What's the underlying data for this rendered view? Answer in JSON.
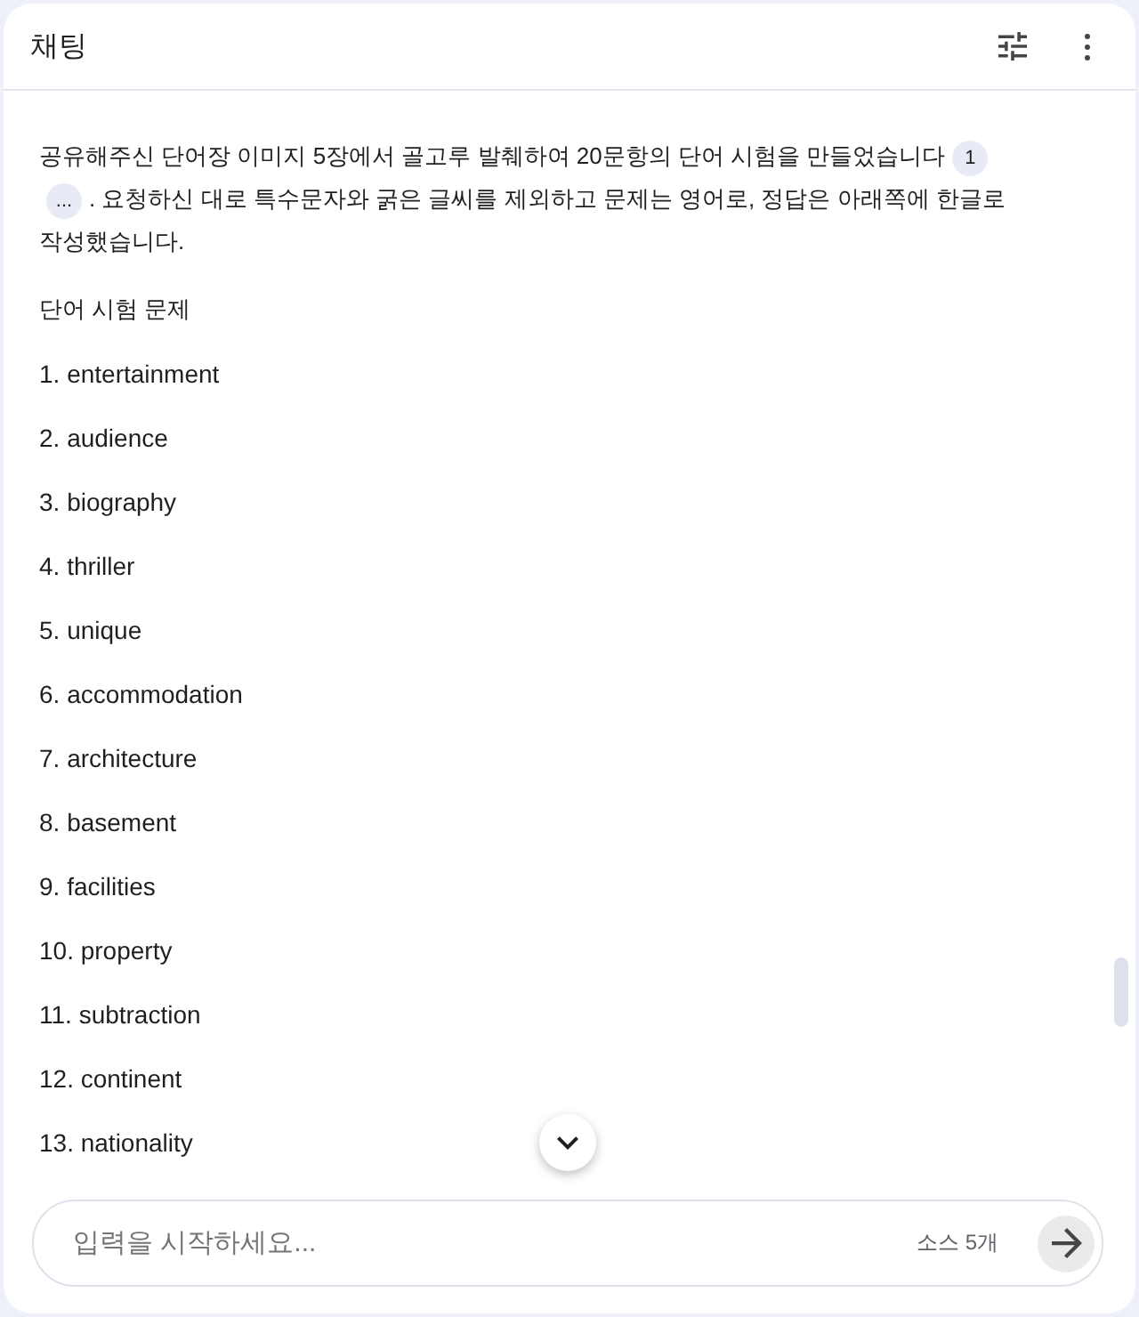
{
  "header": {
    "title": "채팅"
  },
  "message": {
    "intro_before": "공유해주신 단어장 이미지 5장에서 골고루 발췌하여 20문항의 단어 시험을 만들었습니다",
    "citations": [
      {
        "label": "1"
      },
      {
        "label": "..."
      }
    ],
    "intro_after": ". 요청하신 대로 특수문자와 굵은 글씨를 제외하고 문제는 영어로, 정답은 아래쪽에 한글로 작성했습니다.",
    "heading": "단어 시험 문제",
    "items": [
      "1. entertainment",
      "2. audience",
      "3. biography",
      "4. thriller",
      "5. unique",
      "6. accommodation",
      "7. architecture",
      "8. basement",
      "9. facilities",
      "10. property",
      "11. subtraction",
      "12. continent",
      "13. nationality"
    ]
  },
  "composer": {
    "placeholder": "입력을 시작하세요...",
    "source_count": "소스 5개"
  }
}
